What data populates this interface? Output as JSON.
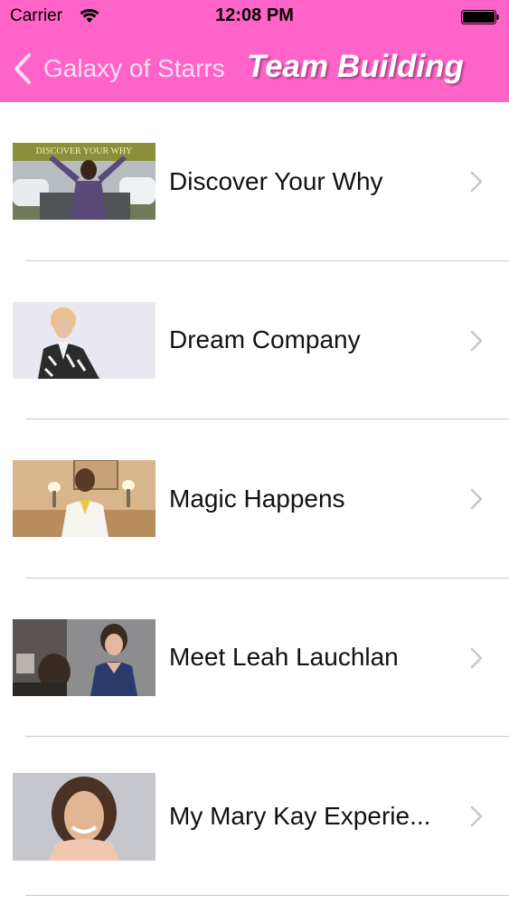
{
  "status_bar": {
    "carrier": "Carrier",
    "time": "12:08 PM"
  },
  "nav": {
    "back_label": "Galaxy of Starrs",
    "title": "Team Building",
    "header_color": "#ff63c8"
  },
  "list": {
    "items": [
      {
        "label": "Discover Your Why",
        "thumb_caption": "DISCOVER YOUR WHY"
      },
      {
        "label": "Dream Company"
      },
      {
        "label": "Magic Happens"
      },
      {
        "label": "Meet Leah Lauchlan"
      },
      {
        "label": "My Mary Kay Experie..."
      }
    ]
  },
  "icons": {
    "back": "chevron-left-icon",
    "row_disclosure": "chevron-right-icon",
    "wifi": "wifi-icon",
    "battery": "battery-icon"
  }
}
